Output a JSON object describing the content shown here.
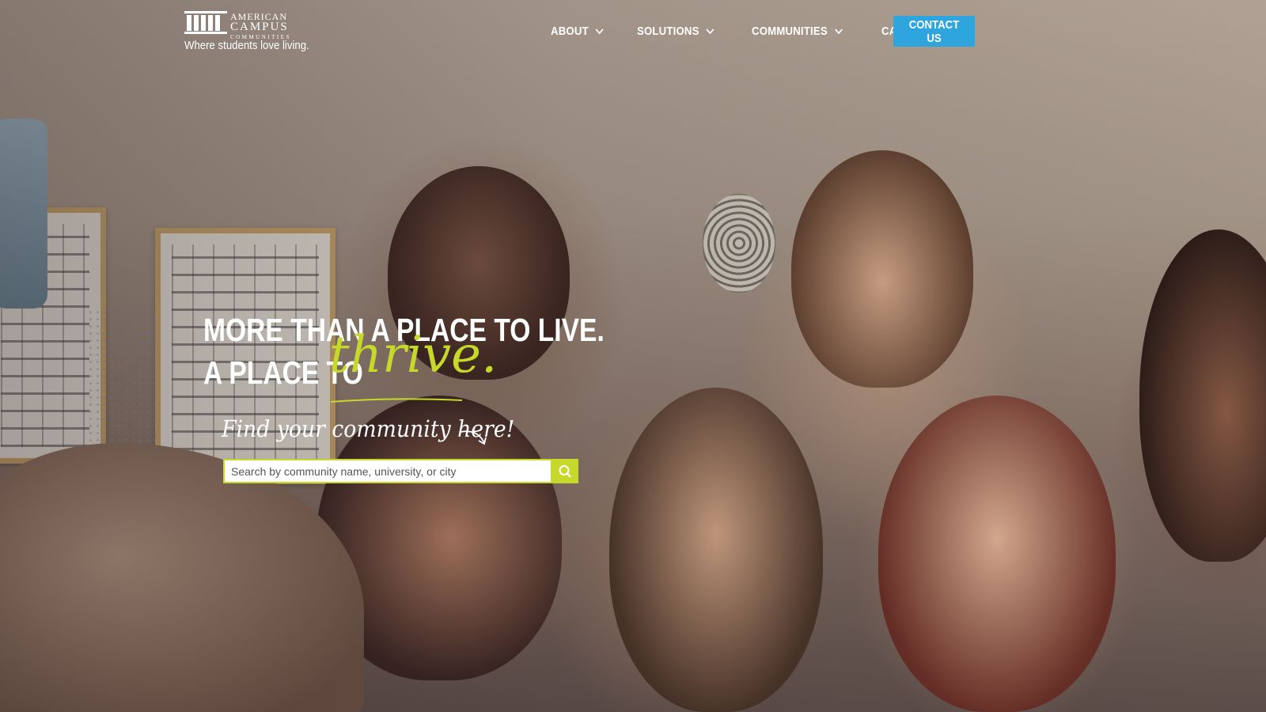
{
  "brand": {
    "line1": "AMERICAN",
    "line2": "CAMPUS",
    "line3": "COMMUNITIES",
    "tagline": "Where students love living.",
    "accent_color": "#c6d82a",
    "button_color": "#2fa5dd"
  },
  "nav": {
    "items": [
      {
        "label": "ABOUT",
        "has_dropdown": true,
        "icon": "chevron-down-icon"
      },
      {
        "label": "SOLUTIONS",
        "has_dropdown": true,
        "icon": "chevron-down-icon"
      },
      {
        "label": "COMMUNITIES",
        "has_dropdown": true,
        "icon": "chevron-down-icon"
      },
      {
        "label": "CAREERS",
        "has_dropdown": false
      }
    ],
    "contact_label": "CONTACT US"
  },
  "hero": {
    "headline_line1": "MORE THAN A PLACE TO LIVE.",
    "headline_line2": "A PLACE TO",
    "highlight_word": "thrive.",
    "find_text": "Find your community here!",
    "search_placeholder": "Search by community name, university, or city",
    "search_icon": "search-icon"
  }
}
